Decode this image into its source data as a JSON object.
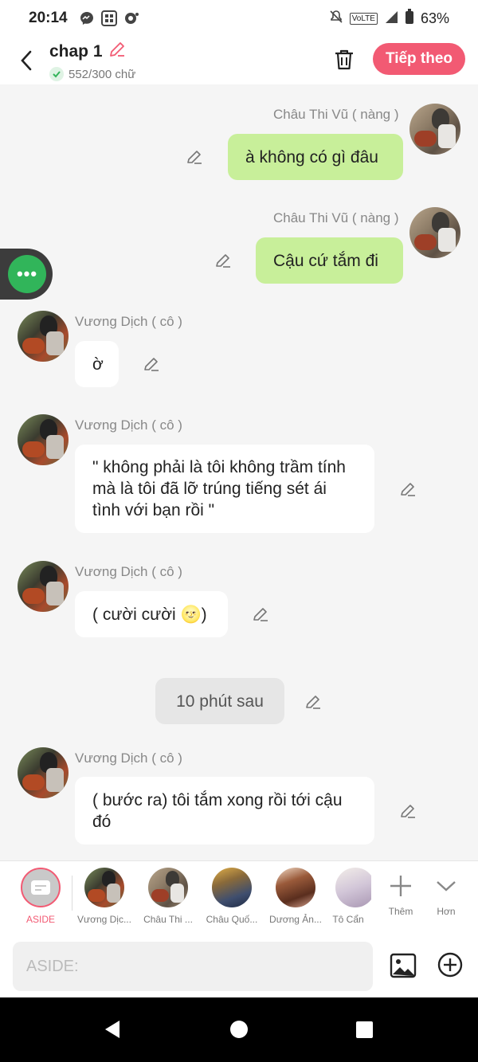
{
  "status": {
    "time": "20:14",
    "battery": "63%",
    "network": "VoLTE",
    "signal": "4G"
  },
  "header": {
    "title": "chap 1",
    "word_count": "552/300 chữ",
    "next_label": "Tiếp theo"
  },
  "messages": [
    {
      "side": "right",
      "name": "Châu Thi Vũ ( nàng )",
      "text": "à không có gì đâu"
    },
    {
      "side": "right",
      "name": "Châu Thi Vũ ( nàng )",
      "text": "Cậu cứ tắm đi"
    },
    {
      "side": "left",
      "name": "Vương Dịch ( cô )",
      "text": "ờ"
    },
    {
      "side": "left",
      "name": "Vương Dịch ( cô )",
      "text": "\" không phải là tôi không trầm tính mà là tôi đã lỡ trúng tiếng sét ái tình với bạn rồi \""
    },
    {
      "side": "left",
      "name": "Vương Dịch ( cô )",
      "text": "( cười cười 🌝)"
    },
    {
      "side": "center",
      "text": "10 phút sau"
    },
    {
      "side": "left",
      "name": "Vương Dịch ( cô )",
      "text": "( bước ra) tôi tắm xong rồi tới cậu đó"
    }
  ],
  "characters": [
    {
      "label": "ASIDE"
    },
    {
      "label": "Vương Dịc..."
    },
    {
      "label": "Châu Thi ..."
    },
    {
      "label": "Châu Quố..."
    },
    {
      "label": "Dương Ản..."
    },
    {
      "label": "Tô Cẩn"
    }
  ],
  "actions": {
    "add_label": "Thêm",
    "more_label": "Hơn"
  },
  "input": {
    "placeholder": "ASIDE:"
  },
  "floating_button": {
    "label": "•••"
  }
}
